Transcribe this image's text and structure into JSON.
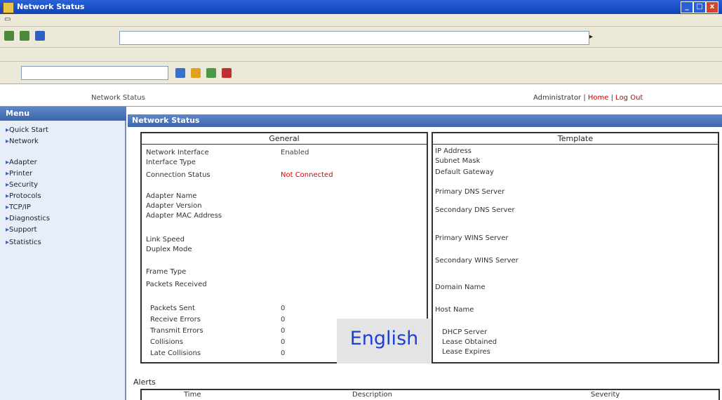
{
  "window": {
    "title": "Network Status"
  },
  "header": {
    "breadcrumb": "Network Status",
    "right_links": [
      "Administrator",
      "Home",
      "Log Out"
    ]
  },
  "sidebar": {
    "title": "Menu",
    "items": [
      "Quick Start",
      "Network",
      "Adapter",
      "Printer",
      "Security",
      "Protocols",
      "TCP/IP",
      "Diagnostics",
      "Support",
      "Statistics"
    ]
  },
  "main": {
    "title": "Network Status",
    "general": {
      "title": "General",
      "rows": [
        {
          "label": "Network Interface",
          "value": "Enabled"
        },
        {
          "label": "Interface Type",
          "value": ""
        },
        {
          "label": "Connection Status",
          "value": "Not Connected",
          "status_color": "#dd0000"
        },
        {
          "label": "Adapter Name",
          "value": ""
        },
        {
          "label": "Adapter Version",
          "value": ""
        },
        {
          "label": "Adapter MAC Address",
          "value": ""
        },
        {
          "label": "Link Speed",
          "value": ""
        },
        {
          "label": "Duplex Mode",
          "value": ""
        },
        {
          "label": "Frame Type",
          "value": ""
        },
        {
          "label": "Packets Received",
          "value": ""
        },
        {
          "label": "Packets Sent",
          "value": "0"
        },
        {
          "label": "Receive Errors",
          "value": "0"
        },
        {
          "label": "Transmit Errors",
          "value": "0"
        },
        {
          "label": "Collisions",
          "value": "0"
        },
        {
          "label": "Late Collisions",
          "value": "0"
        }
      ]
    },
    "template": {
      "title": "Template",
      "rows": [
        {
          "label": "IP Address",
          "value": ""
        },
        {
          "label": "Subnet Mask",
          "value": ""
        },
        {
          "label": "Default Gateway",
          "value": ""
        },
        {
          "label": "Primary DNS Server",
          "value": ""
        },
        {
          "label": "Secondary DNS Server",
          "value": ""
        },
        {
          "label": "Primary WINS Server",
          "value": ""
        },
        {
          "label": "Secondary WINS Server",
          "value": ""
        },
        {
          "label": "Domain Name",
          "value": ""
        },
        {
          "label": "Host Name",
          "value": ""
        },
        {
          "label": "DHCP Server",
          "value": ""
        },
        {
          "label": "Lease Obtained",
          "value": ""
        },
        {
          "label": "Lease Expires",
          "value": ""
        }
      ]
    },
    "alerts": {
      "title": "Alerts",
      "columns": [
        "Time",
        "Description",
        "Severity"
      ]
    }
  },
  "overlay": {
    "language": "English"
  }
}
